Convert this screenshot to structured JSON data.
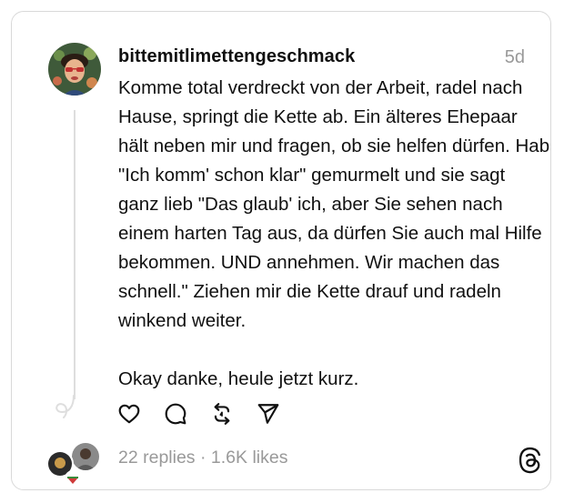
{
  "post": {
    "username": "bittemitlimettengeschmack",
    "time": "5d",
    "text": "Komme total verdreckt von der Arbeit, radel nach Hause, springt die Kette ab. Ein älteres Ehepaar hält neben mir und fragen, ob sie helfen dürfen. Hab \"Ich komm' schon klar\" gemurmelt und sie sagt ganz lieb \"Das glaub' ich, aber Sie sehen nach einem harten Tag aus, da dürfen Sie auch mal Hilfe bekommen. UND annehmen. Wir machen das schnell.\" Ziehen mir die Kette drauf und radeln winkend weiter.\n\nOkay danke, heule jetzt kurz."
  },
  "actions": [
    "heart-icon",
    "comment-icon",
    "repost-icon",
    "share-icon"
  ],
  "stats": {
    "replies": "22 replies",
    "separator": "·",
    "likes": "1.6K likes"
  },
  "colors": {
    "text": "#101010",
    "muted": "#999999",
    "border": "#d9d9d9"
  }
}
